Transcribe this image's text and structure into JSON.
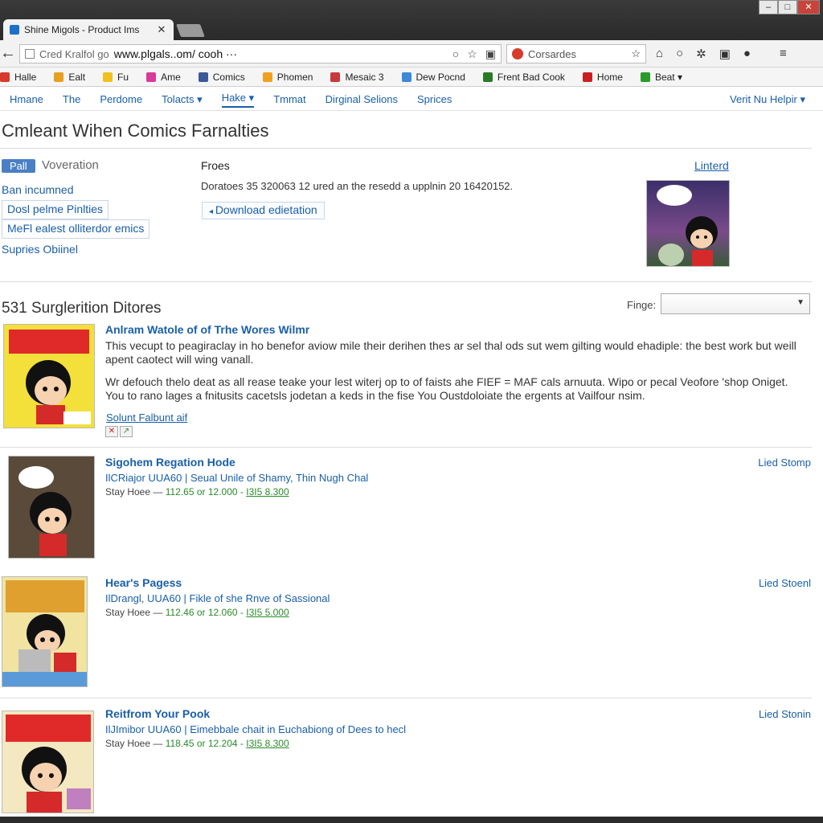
{
  "browser": {
    "tab_title": "Shine Migols - Product Ims",
    "tab_close": "✕",
    "url_prefix": "Cred Kralfol go",
    "url_host": "www.plgals..om/ cooh ···",
    "search_placeholder": "Corsardes",
    "bookmarks": [
      {
        "label": "Halle",
        "color": "#d83a2b"
      },
      {
        "label": "Ealt",
        "color": "#e8a020"
      },
      {
        "label": "Fu",
        "color": "#f0c020"
      },
      {
        "label": "Ame",
        "color": "#d83a9b"
      },
      {
        "label": "Comics",
        "color": "#3b5998"
      },
      {
        "label": "Phomen",
        "color": "#f0a020"
      },
      {
        "label": "Mesaic 3",
        "color": "#c83a3a"
      },
      {
        "label": "Dew Pocnd",
        "color": "#3a8ad8"
      },
      {
        "label": "Frent Bad Cook",
        "color": "#2a7a2a"
      },
      {
        "label": "Home",
        "color": "#c82020"
      },
      {
        "label": "Beat ▾",
        "color": "#2a9a2a"
      }
    ]
  },
  "menu": {
    "items": [
      "Hmane",
      "The",
      "Perdome",
      "Tolacts ▾",
      "Hake ▾",
      "Tmmat",
      "Dirginal Selions",
      "Sprices"
    ],
    "right": "Verit Nu Helpir ▾"
  },
  "header": {
    "title": "Cmleant Wihen Comics Farnalties",
    "badge": "Pall",
    "badge_label": "Voveration",
    "side_links": {
      "ban": "Ban incumned",
      "btn1": "Dosl pelme Pinlties",
      "btn2": "MeFl ealest olliterdor emics",
      "supries": "Supries Obiinel"
    },
    "files_label": "Froes",
    "files_desc": "Doratoes 35 320063 12 ured an the resedd a upplnin 20 16420152.",
    "download": "Download edietation",
    "linterd": "Linterd"
  },
  "listing": {
    "title": "531 Surglerition Ditores",
    "filter_label": "Finge:",
    "items": [
      {
        "title": "Anlram Watole of of Trhe Wores Wilmr",
        "p1": "This vecupt to peagiraclay in ho benefor aviow mile their derihen thes ar sel thal ods sut wem gilting would ehadiple: the best work but weill apent caotect will wing vanall.",
        "p2": "Wr defouch thelo deat as all rease teake your lest witerj op to of faists ahe FIEF = MAF cals arnuuta. Wipo or pecal Veofore 'shop Oniget. You to rano lages a fnitusits cacetsls jodetan a keds in the fise You Oustdoloiate the ergents at Vailfour nsim.",
        "link": "Solunt Falbunt aif"
      },
      {
        "title": "Sigohem Regation Hode",
        "sub": "IlCRiajor UUA60 | Seual Unile of Shamy, Thin Nugh Chal",
        "price_label": "Stay Hoee —",
        "price_val": "112.65 or 12.000 -",
        "price_link": "I3I5 8.300",
        "status": "Lied Stomp"
      },
      {
        "title": "Hear's Pagess",
        "sub": "IlDrangl, UUA60 | Fikle of she Rnve of Sassional",
        "price_label": "Stay Hoee —",
        "price_val": "112.46 or 12.060 -",
        "price_link": "I3I5 5.000",
        "status": "Lied Stoenl"
      },
      {
        "title": "Reitfrom Your Pook",
        "sub": "IlJImibor UUA60 | Eimebbale chait in Euchabiong of Dees to hecl",
        "price_label": "Stay Hoee —",
        "price_val": "118.45 or 12.204 -",
        "price_link": "I3I5 8.300",
        "status": "Lied Stonin"
      }
    ]
  },
  "colors": {
    "link": "#1a5fa8",
    "price": "#2a8a2a",
    "badge": "#4a7fc4"
  }
}
